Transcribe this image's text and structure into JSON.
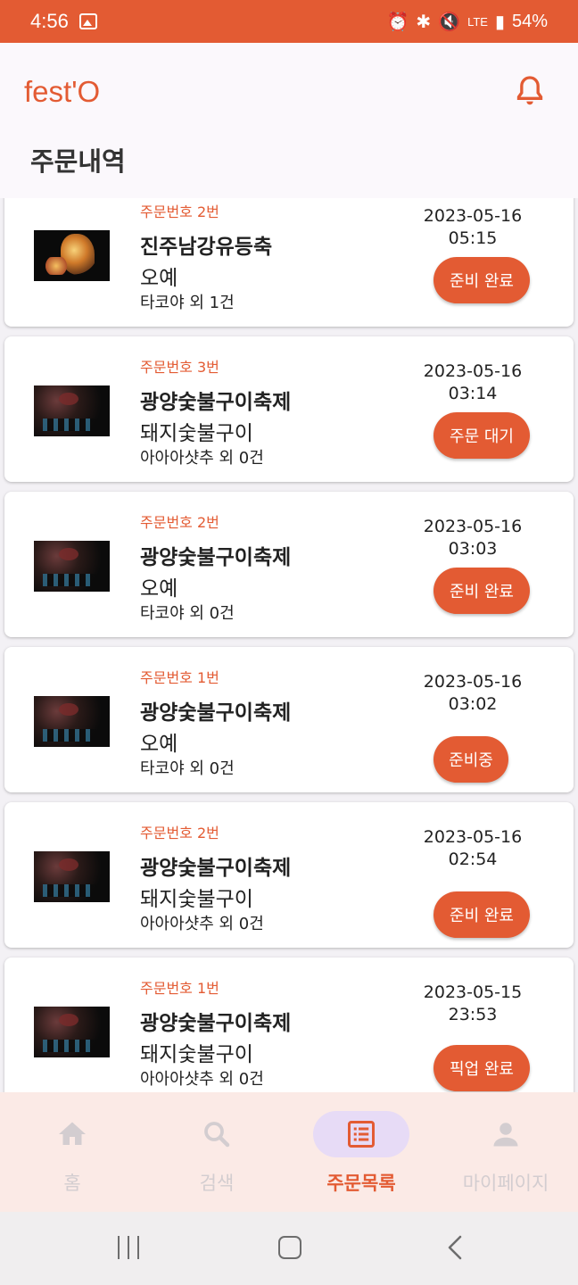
{
  "status_bar": {
    "time": "4:56",
    "network": "LTE",
    "battery": "54%"
  },
  "app": {
    "brand": "fest'O",
    "title": "주문내역"
  },
  "orders": [
    {
      "order_no": "주문번호 2번",
      "festival": "진주남강유등축",
      "menu": "오예",
      "summary": "타코야 외 1건",
      "date": "2023-05-16",
      "time": "05:15",
      "status": "준비 완료",
      "thumb": "dragon-lantern-thumbnail"
    },
    {
      "order_no": "주문번호 3번",
      "festival": "광양숯불구이축제",
      "menu": "돼지숯불구이",
      "summary": "아아아샷추 외 0건",
      "date": "2023-05-16",
      "time": "03:14",
      "status": "주문 대기",
      "thumb": "night-fireworks-thumbnail"
    },
    {
      "order_no": "주문번호 2번",
      "festival": "광양숯불구이축제",
      "menu": "오예",
      "summary": "타코야 외 0건",
      "date": "2023-05-16",
      "time": "03:03",
      "status": "준비 완료",
      "thumb": "night-fireworks-thumbnail"
    },
    {
      "order_no": "주문번호 1번",
      "festival": "광양숯불구이축제",
      "menu": "오예",
      "summary": "타코야 외 0건",
      "date": "2023-05-16",
      "time": "03:02",
      "status": "준비중",
      "thumb": "night-fireworks-thumbnail"
    },
    {
      "order_no": "주문번호 2번",
      "festival": "광양숯불구이축제",
      "menu": "돼지숯불구이",
      "summary": "아아아샷추 외 0건",
      "date": "2023-05-16",
      "time": "02:54",
      "status": "준비 완료",
      "thumb": "night-fireworks-thumbnail"
    },
    {
      "order_no": "주문번호 1번",
      "festival": "광양숯불구이축제",
      "menu": "돼지숯불구이",
      "summary": "아아아샷추 외 0건",
      "date": "2023-05-15",
      "time": "23:53",
      "status": "픽업 완료",
      "thumb": "night-fireworks-thumbnail"
    }
  ],
  "bottom_nav": [
    {
      "label": "홈",
      "icon": "home-icon",
      "active": false
    },
    {
      "label": "검색",
      "icon": "search-icon",
      "active": false
    },
    {
      "label": "주문목록",
      "icon": "order-list-icon",
      "active": true
    },
    {
      "label": "마이페이지",
      "icon": "person-icon",
      "active": false
    }
  ],
  "colors": {
    "accent": "#e35b33",
    "nav_background": "#fbeae6",
    "active_pill": "#e7dbf6",
    "app_background": "#fbf8fc"
  }
}
